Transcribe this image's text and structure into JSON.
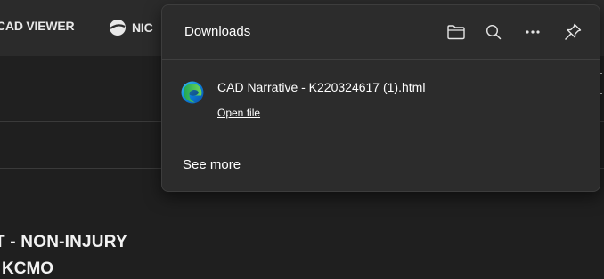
{
  "favorites": {
    "items": [
      {
        "label": "CAD VIEWER"
      },
      {
        "label": "NIC"
      }
    ]
  },
  "page": {
    "incident_title": "T - NON-INJURY",
    "incident_subtitle": "KCMO"
  },
  "downloads": {
    "title": "Downloads",
    "header_icons": [
      "folder-icon",
      "search-icon",
      "more-icon",
      "pin-icon"
    ],
    "items": [
      {
        "file_name": "CAD Narrative - K220324617 (1).html",
        "action_label": "Open file",
        "icon": "edge-browser-icon"
      }
    ],
    "see_more_label": "See more"
  },
  "colors": {
    "flyout_bg": "#2c2c2c",
    "page_bg": "#1f1f1f",
    "favbar_bg": "#2b2b2b",
    "edge_blue": "#0c7bd6",
    "edge_green": "#5ad14a"
  }
}
